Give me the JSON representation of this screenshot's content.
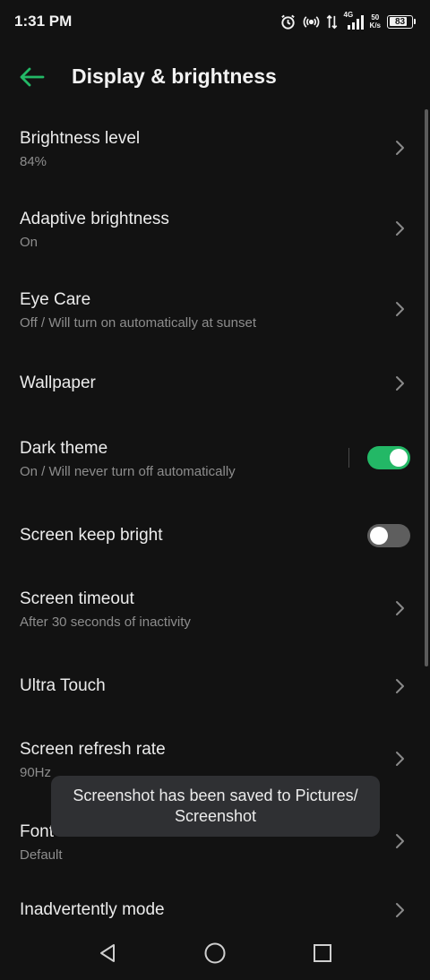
{
  "status_bar": {
    "time": "1:31 PM",
    "network": "4G",
    "speed_value": "50",
    "speed_unit": "K/s",
    "battery": "83",
    "battery_level": 0.83,
    "icons": [
      "alarm-icon",
      "hotspot-icon",
      "data-arrows-icon",
      "signal-icon"
    ]
  },
  "header": {
    "title": "Display & brightness",
    "back_icon": "arrow-left-icon",
    "accent": "#23b866"
  },
  "settings": [
    {
      "title": "Brightness level",
      "subtitle": "84%",
      "control": "chevron"
    },
    {
      "title": "Adaptive brightness",
      "subtitle": "On",
      "control": "chevron"
    },
    {
      "title": "Eye Care",
      "subtitle": "Off / Will turn on automatically at sunset",
      "control": "chevron"
    },
    {
      "title": "Wallpaper",
      "subtitle": "",
      "control": "chevron"
    },
    {
      "title": "Dark theme",
      "subtitle": "On / Will never turn off automatically",
      "control": "toggle",
      "toggle_on": true
    },
    {
      "title": "Screen keep bright",
      "subtitle": "",
      "control": "toggle",
      "toggle_on": false
    },
    {
      "title": "Screen timeout",
      "subtitle": "After 30 seconds of inactivity",
      "control": "chevron"
    },
    {
      "title": "Ultra Touch",
      "subtitle": "",
      "control": "chevron"
    },
    {
      "title": "Screen refresh rate",
      "subtitle": "90Hz",
      "control": "chevron"
    },
    {
      "title": "Font size",
      "subtitle": "Default",
      "control": "chevron"
    },
    {
      "title": "Inadvertently mode",
      "subtitle": "",
      "control": "chevron"
    }
  ],
  "toast": {
    "line1": "Screenshot has been saved to  Pictures/",
    "line2": "Screenshot"
  },
  "nav_bar": {
    "icons": [
      "back-triangle-icon",
      "home-circle-icon",
      "recents-square-icon"
    ]
  }
}
